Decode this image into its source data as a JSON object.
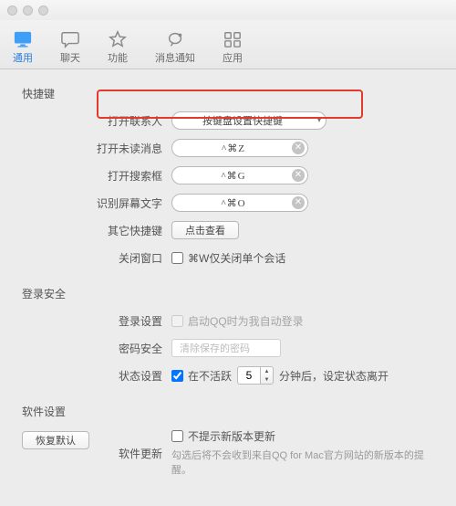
{
  "tabs": {
    "general": "通用",
    "chat": "聊天",
    "features": "功能",
    "notifications": "消息通知",
    "apps": "应用"
  },
  "sections": {
    "shortcuts": "快捷键",
    "login": "登录安全",
    "software": "软件设置"
  },
  "shortcuts": {
    "open_contacts_label": "打开联系人",
    "open_contacts_field": "按键盘设置快捷键",
    "open_unread_label": "打开未读消息",
    "open_unread_key": "^⌘Z",
    "open_search_label": "打开搜索框",
    "open_search_key": "^⌘G",
    "ocr_label": "识别屏幕文字",
    "ocr_key": "^⌘O",
    "others_label": "其它快捷键",
    "others_btn": "点击查看",
    "close_window_label": "关闭窗口",
    "close_window_chk": "⌘W仅关闭单个会话"
  },
  "login": {
    "login_settings_label": "登录设置",
    "login_settings_chk": "启动QQ时为我自动登录",
    "password_label": "密码安全",
    "password_placeholder": "清除保存的密码",
    "status_label": "状态设置",
    "status_chk_pre": "在不活跃",
    "status_value": "5",
    "status_chk_post": "分钟后，设定状态离开"
  },
  "software": {
    "update_label": "软件更新",
    "update_chk": "不提示新版本更新",
    "update_hint": "勾选后将不会收到来自QQ for Mac官方网站的新版本的提醒。"
  },
  "restore": "恢复默认"
}
